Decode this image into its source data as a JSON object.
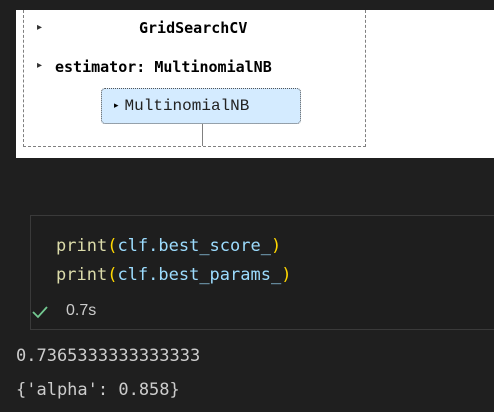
{
  "widget": {
    "toggle_glyph": "▸",
    "gridsearch_label": "GridSearchCV",
    "estimator_label": "estimator: MultinomialNB",
    "inner_estimator_label": "MultinomialNB"
  },
  "cell": {
    "line1": {
      "fn": "print",
      "open": "(",
      "arg": "clf.best_score_",
      "close": ")"
    },
    "line2": {
      "fn": "print",
      "open": "(",
      "arg": "clf.best_params_",
      "close": ")"
    },
    "status_icon": "check-icon",
    "status_color": "#73c991",
    "duration": "0.7s"
  },
  "outputs": {
    "best_score": "0.7365333333333333",
    "best_params": "{'alpha': 0.858}"
  }
}
